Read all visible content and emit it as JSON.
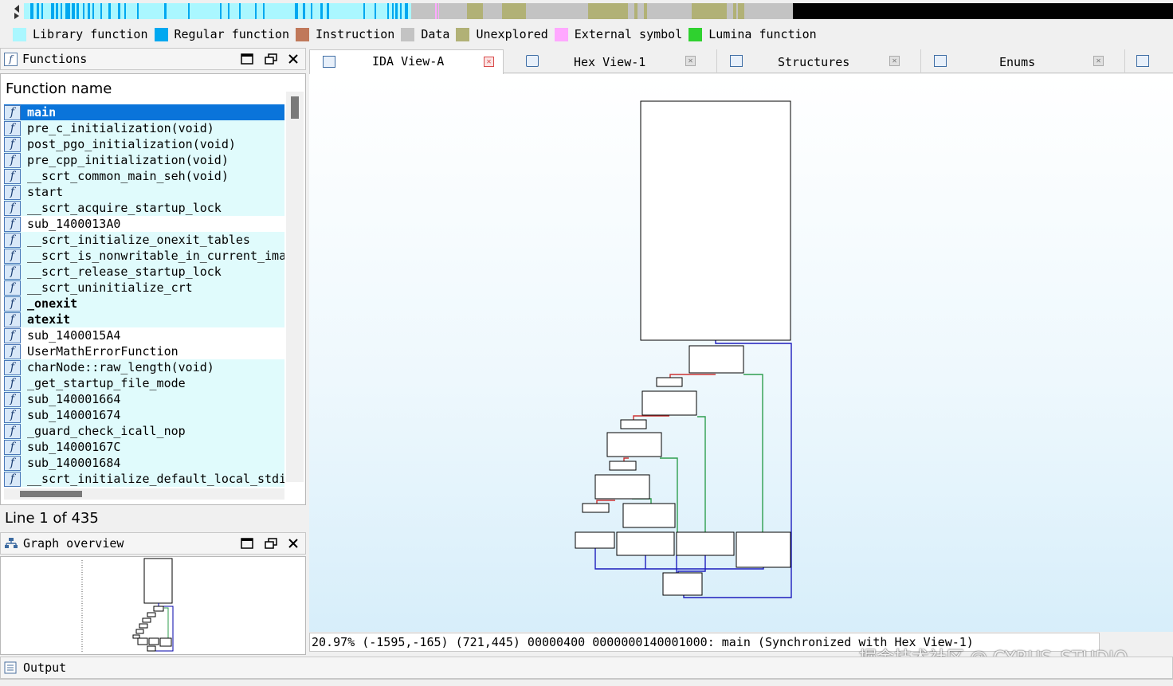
{
  "legend": [
    {
      "label": "Library function",
      "color": "#aaf7ff"
    },
    {
      "label": "Regular function",
      "color": "#00a8f0"
    },
    {
      "label": "Instruction",
      "color": "#c0785a"
    },
    {
      "label": "Data",
      "color": "#c3c3c3"
    },
    {
      "label": "Unexplored",
      "color": "#b1b176"
    },
    {
      "label": "External symbol",
      "color": "#ffa8ff"
    },
    {
      "label": "Lumina function",
      "color": "#2fd12f"
    }
  ],
  "functions_panel": {
    "title": "Functions",
    "column_header": "Function name",
    "items": [
      {
        "label": "main",
        "selected": true,
        "bold": true
      },
      {
        "label": "pre_c_initialization(void)"
      },
      {
        "label": "post_pgo_initialization(void)"
      },
      {
        "label": "pre_cpp_initialization(void)"
      },
      {
        "label": "__scrt_common_main_seh(void)"
      },
      {
        "label": "start"
      },
      {
        "label": "__scrt_acquire_startup_lock"
      },
      {
        "label": "sub_1400013A0"
      },
      {
        "label": "__scrt_initialize_onexit_tables"
      },
      {
        "label": "__scrt_is_nonwritable_in_current_ima"
      },
      {
        "label": "__scrt_release_startup_lock"
      },
      {
        "label": "__scrt_uninitialize_crt"
      },
      {
        "label": "_onexit",
        "bold": true
      },
      {
        "label": "atexit",
        "bold": true
      },
      {
        "label": "sub_1400015A4"
      },
      {
        "label": "UserMathErrorFunction"
      },
      {
        "label": "charNode::raw_length(void)"
      },
      {
        "label": "_get_startup_file_mode"
      },
      {
        "label": "sub_140001664"
      },
      {
        "label": "sub_140001674"
      },
      {
        "label": "_guard_check_icall_nop"
      },
      {
        "label": "sub_14000167C"
      },
      {
        "label": "sub_140001684"
      },
      {
        "label": "__scrt_initialize_default_local_stdi"
      }
    ],
    "line_status": "Line 1 of 435"
  },
  "graph_overview": {
    "title": "Graph overview"
  },
  "tabs": [
    {
      "label": "IDA View-A",
      "active": true,
      "icon": "ida-view-icon"
    },
    {
      "label": "Hex View-1",
      "active": false,
      "icon": "hex-view-icon"
    },
    {
      "label": "Structures",
      "active": false,
      "icon": "structures-icon"
    },
    {
      "label": "Enums",
      "active": false,
      "icon": "enums-icon"
    }
  ],
  "graph_status": "20.97% (-1595,-165) (721,445) 00000400 0000000140001000: main (Synchronized with Hex View-1)",
  "watermark": "掘金技术社区 @ CYRUS_STUDIO",
  "output_panel": {
    "title": "Output"
  }
}
